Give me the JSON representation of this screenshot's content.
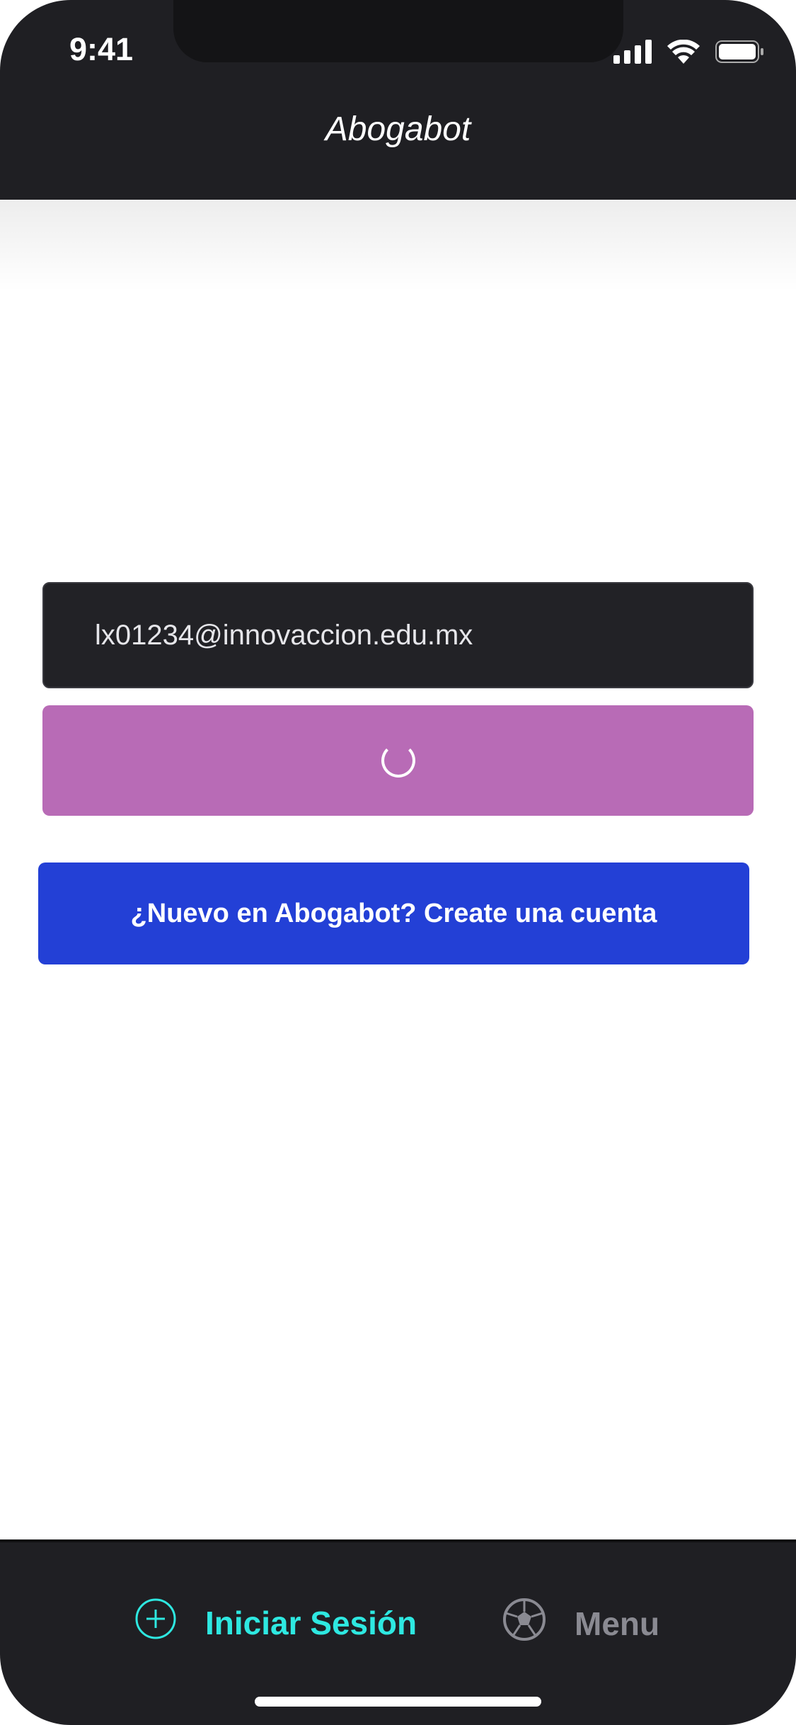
{
  "status_bar": {
    "time": "9:41",
    "icons": [
      "signal-icon",
      "wifi-icon",
      "battery-icon"
    ]
  },
  "header": {
    "title": "Abogabot"
  },
  "form": {
    "email_value": "lx01234@innovaccion.edu.mx",
    "login_button_state": "loading",
    "signup_label": "¿Nuevo en Abogabot? Create una cuenta"
  },
  "tabbar": {
    "tabs": [
      {
        "label": "Iniciar Sesión",
        "icon": "plus-circle-icon",
        "active": true
      },
      {
        "label": "Menu",
        "icon": "soccer-ball-icon",
        "active": false
      }
    ]
  },
  "colors": {
    "header_bg": "#1f1f23",
    "login_button": "#b86bb6",
    "signup_button": "#2340d6",
    "active_tab": "#2ee8e1",
    "inactive_tab": "#8a8a92"
  }
}
